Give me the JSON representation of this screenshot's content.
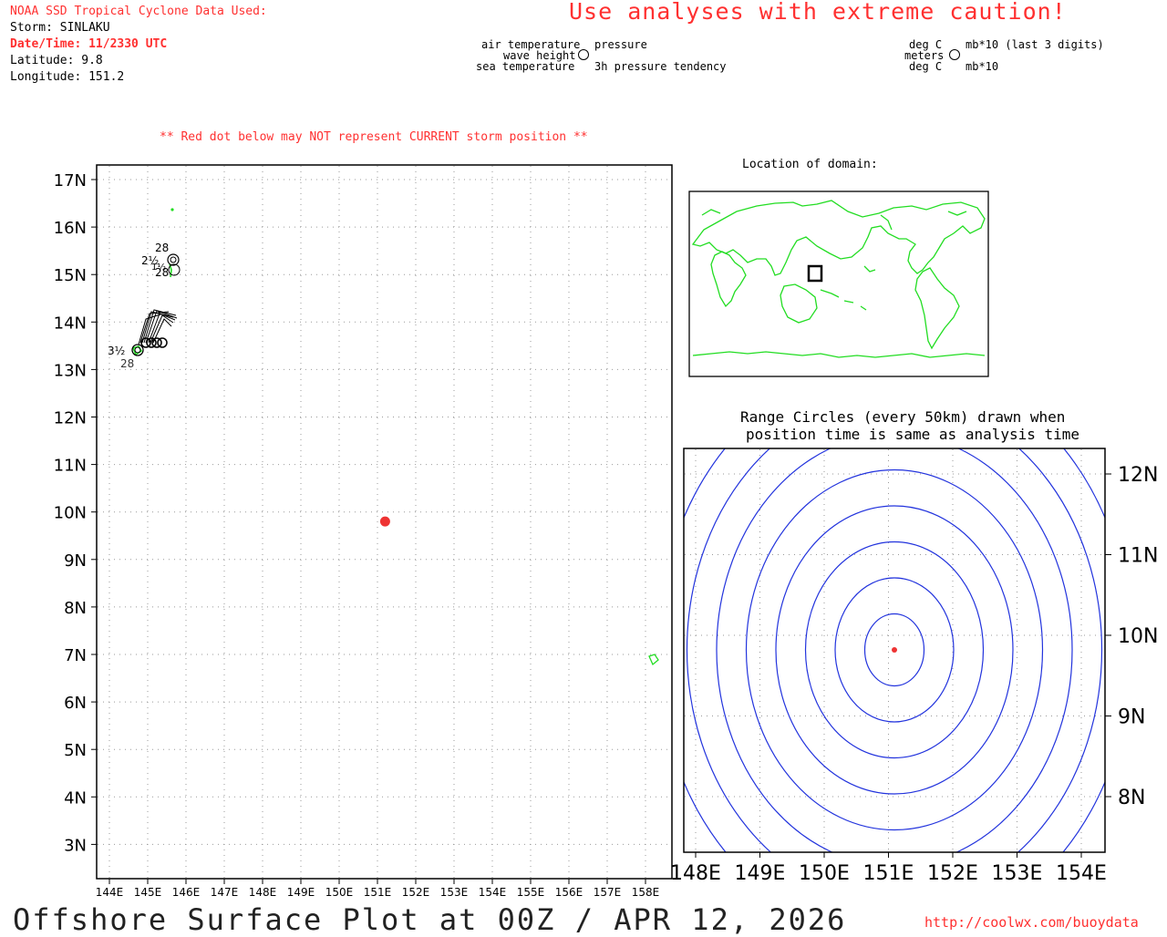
{
  "header": {
    "title": "NOAA SSD Tropical Cyclone Data Used:",
    "storm": "Storm: SINLAKU",
    "datetime": "Date/Time: 11/2330 UTC",
    "latitude": "Latitude: 9.8",
    "longitude": "Longitude: 151.2",
    "caution": "Use analyses with extreme caution!"
  },
  "legend": {
    "air_temperature": "air temperature",
    "wave_height": "wave height",
    "sea_temperature": "sea temperature",
    "pressure": "pressure",
    "pressure_tendency": "3h pressure tendency",
    "air_temp_unit": "deg C",
    "wave_unit": "meters",
    "sea_temp_unit": "deg C",
    "pressure_unit": "mb*10 (last 3 digits)",
    "tendency_unit": "mb*10"
  },
  "note": "** Red dot below may NOT represent CURRENT storm position **",
  "main_map": {
    "lat_labels": [
      "17N",
      "16N",
      "15N",
      "14N",
      "13N",
      "12N",
      "11N",
      "10N",
      "9N",
      "8N",
      "7N",
      "6N",
      "5N",
      "4N",
      "3N"
    ],
    "lon_labels": [
      "144E",
      "145E",
      "146E",
      "147E",
      "148E",
      "149E",
      "150E",
      "151E",
      "152E",
      "153E",
      "154E",
      "155E",
      "156E",
      "157E",
      "158E"
    ],
    "storm_position": {
      "lat": 9.8,
      "lon": 151.2
    },
    "stations": [
      {
        "top": "28",
        "left": "2½",
        "bottom": "28",
        "label_extra": "1½",
        "lat": 15.3,
        "lon": 145.7
      },
      {
        "left": "3½",
        "bottom": "28",
        "lat": 13.4,
        "lon": 144.8
      }
    ],
    "colors": {
      "land": "#22dd22",
      "storm": "#ee3333",
      "grid": "#999999"
    }
  },
  "domain_map": {
    "label": "Location of domain:"
  },
  "range_map": {
    "title_line1": "Range Circles (every 50km) drawn when",
    "title_line2": "position time is same as analysis time",
    "lat_labels": [
      "12N",
      "11N",
      "10N",
      "9N",
      "8N"
    ],
    "lon_labels": [
      "148E",
      "149E",
      "150E",
      "151E",
      "152E",
      "153E",
      "154E"
    ],
    "circle_color": "#2233dd",
    "circle_count": 8
  },
  "footer": {
    "title": "Offshore Surface Plot at 00Z / APR 12, 2026",
    "url": "http://coolwx.com/buoydata"
  }
}
